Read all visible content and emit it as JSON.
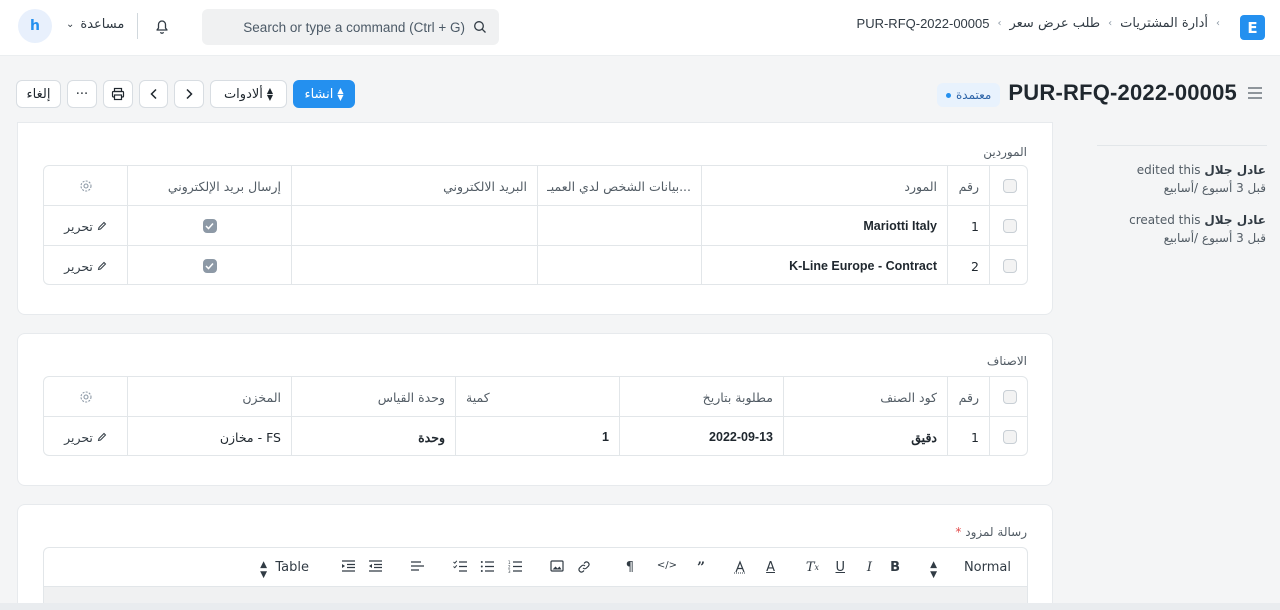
{
  "navbar": {
    "avatar_letter": "h",
    "help_label": "مساعدة",
    "search_placeholder": "Search or type a command (Ctrl + G)",
    "breadcrumb": [
      "أدارة المشتريات",
      "طلب عرض سعر",
      "PUR-RFQ-2022-00005"
    ],
    "logo_letter": "E"
  },
  "page": {
    "title": "PUR-RFQ-2022-00005",
    "status": "معتمدة",
    "buttons": {
      "create": "انشاء",
      "tools": "ألادوات",
      "cancel": "إلغاء",
      "more": "···"
    }
  },
  "timeline": [
    {
      "user": "عادل جلال",
      "action": "edited this",
      "time": "قبل 3 أسبوع /أسابيع"
    },
    {
      "user": "عادل جلال",
      "action": "created this",
      "time": "قبل 3 أسبوع /أسابيع"
    }
  ],
  "suppliers": {
    "label": "الموردين",
    "columns": {
      "no": "رقم",
      "supplier": "المورد",
      "contact": "بيانات الشخص لدي العميـ...",
      "email": "البريد الالكتروني",
      "send_email": "إرسال بريد الإلكتروني"
    },
    "rows": [
      {
        "no": "1",
        "supplier": "Mariotti Italy",
        "contact": "",
        "email": "",
        "edit": "تحرير"
      },
      {
        "no": "2",
        "supplier": "K-Line Europe - Contract",
        "contact": "",
        "email": "",
        "edit": "تحرير"
      }
    ]
  },
  "items": {
    "label": "الاصناف",
    "columns": {
      "no": "رقم",
      "item_code": "كود الصنف",
      "required_by": "مطلوبة بتاريخ",
      "qty": "كمية",
      "uom": "وحدة القياس",
      "warehouse": "المخزن"
    },
    "rows": [
      {
        "no": "1",
        "item_code": "دقيق",
        "required_by": "2022-09-13",
        "qty": "1",
        "uom": "وحدة",
        "warehouse": "مخازن - FS",
        "edit": "تحرير"
      }
    ]
  },
  "message": {
    "label": "رسالة لمزود",
    "required_mark": "*",
    "toolbar": {
      "normal": "Normal",
      "table": "Table"
    }
  },
  "colors": {
    "primary": "#2490ef",
    "status_bg": "#e8f2fd"
  }
}
